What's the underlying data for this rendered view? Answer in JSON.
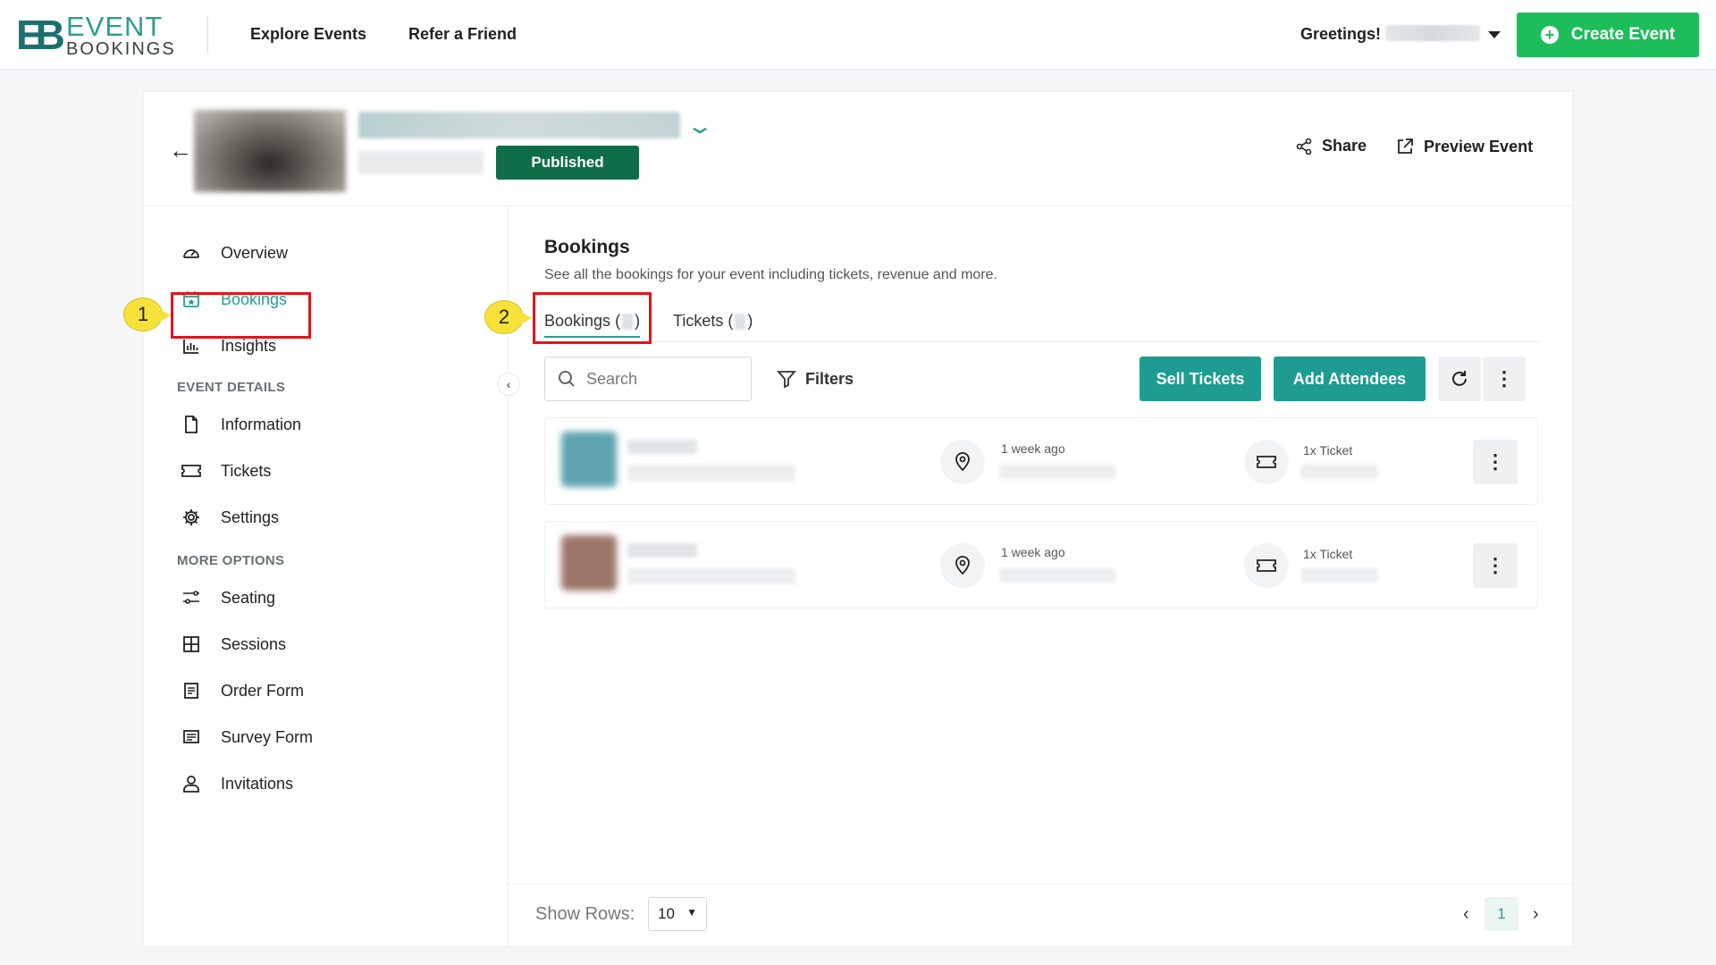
{
  "nav": {
    "logo_line1": "EVENT",
    "logo_line2": "BOOKINGS",
    "links": [
      "Explore Events",
      "Refer a Friend"
    ],
    "greeting": "Greetings!",
    "create_event": "Create Event"
  },
  "event": {
    "status": "Published",
    "share": "Share",
    "preview": "Preview Event"
  },
  "sidebar": {
    "items_top": [
      {
        "label": "Overview",
        "icon": "dashboard-gauge-icon"
      },
      {
        "label": "Bookings",
        "icon": "calendar-star-icon",
        "active": true
      },
      {
        "label": "Insights",
        "icon": "bar-chart-icon"
      }
    ],
    "section_details": "EVENT DETAILS",
    "items_details": [
      {
        "label": "Information",
        "icon": "document-icon"
      },
      {
        "label": "Tickets",
        "icon": "ticket-icon"
      },
      {
        "label": "Settings",
        "icon": "gear-icon"
      }
    ],
    "section_more": "MORE OPTIONS",
    "items_more": [
      {
        "label": "Seating",
        "icon": "sliders-icon"
      },
      {
        "label": "Sessions",
        "icon": "grid-icon"
      },
      {
        "label": "Order Form",
        "icon": "form-icon"
      },
      {
        "label": "Survey Form",
        "icon": "survey-icon"
      },
      {
        "label": "Invitations",
        "icon": "user-icon"
      }
    ]
  },
  "main": {
    "title": "Bookings",
    "subtitle": "See all the bookings for your event including tickets, revenue and more.",
    "tabs": [
      {
        "label": "Bookings",
        "active": true
      },
      {
        "label": "Tickets",
        "active": false
      }
    ],
    "search_placeholder": "Search",
    "filters": "Filters",
    "sell_tickets": "Sell Tickets",
    "add_attendees": "Add Attendees",
    "rows": [
      {
        "time": "1 week ago",
        "tickets": "1x Ticket",
        "avatar_color": "#5fa3b0"
      },
      {
        "time": "1 week ago",
        "tickets": "1x Ticket",
        "avatar_color": "#9b766a"
      }
    ],
    "show_rows_label": "Show Rows:",
    "show_rows_value": "10",
    "page": "1"
  },
  "callouts": {
    "one": "1",
    "two": "2"
  },
  "colors": {
    "accent": "#2a9d94",
    "create_green": "#1dbd5a",
    "published_green": "#0f6e47",
    "highlight_red": "#e0151b",
    "marker_yellow": "#f7e23a"
  }
}
